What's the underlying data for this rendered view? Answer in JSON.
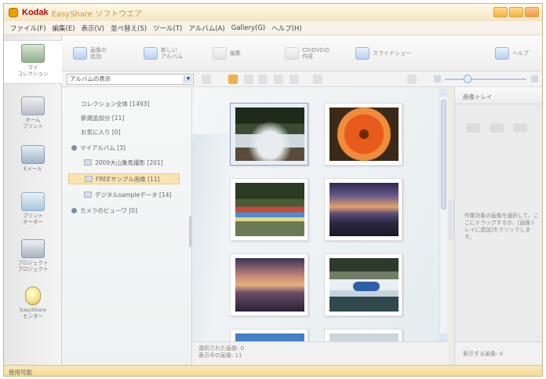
{
  "window": {
    "brand": "Kodak",
    "title": "EasyShare ソフトウエア"
  },
  "menu": [
    "ファイル(F)",
    "編集(E)",
    "表示(V)",
    "並べ替え(S)",
    "ツール(T)",
    "アルバム(A)",
    "Gallery(G)",
    "ヘルプ(H)"
  ],
  "leftnav": [
    {
      "label": "マイ\nコレクション",
      "icon": "my-collection-icon"
    },
    {
      "label": "ホーム\nプリント",
      "icon": "home-print-icon"
    },
    {
      "label": "Eメール",
      "icon": "email-icon"
    },
    {
      "label": "プリント\nオーダー",
      "icon": "print-order-icon"
    },
    {
      "label": "プロジェクト\nプロジェクト",
      "icon": "project-icon"
    },
    {
      "label": "EasyShare\nセンター",
      "icon": "easyshare-center-icon"
    }
  ],
  "toolbar": {
    "import": "画像の\n追加",
    "new_album": "新しい\nアルバム",
    "edit": "編集",
    "create_cd": "CD/DVDの\n作成",
    "slideshow": "スライドショー",
    "help": "ヘルプ"
  },
  "subbar": {
    "album_select": "アルバムの表示"
  },
  "tree": {
    "items": [
      "コレクション全体 [1493]",
      "新規追加分 [11]",
      "お気に入り [0]",
      "マイアルバム [3]",
      "2009大山乗馬撮影 [201]",
      "FREEサンプル画像 [11]",
      "デジタルsampleデータ [14]",
      "カメラのビューワ [0]"
    ]
  },
  "photos": [
    "river",
    "flower",
    "kayaks",
    "sunset-hills",
    "dusk",
    "rafting",
    "sky",
    "pale"
  ],
  "status_left": {
    "line1": "選択された画像: 0",
    "line2": "表示中の画像: 11"
  },
  "tray": {
    "title": "画像トレイ",
    "hint": "作業対象の画像を選択して、ここにドラッグするか、[画像トレイに追加]をクリックします。",
    "footer": "表示する画像: 0"
  },
  "statusbar": "使用可能",
  "colors": {
    "accent": "#f1b04a",
    "brand_red": "#c00000",
    "selection": "#fbe4b3"
  }
}
